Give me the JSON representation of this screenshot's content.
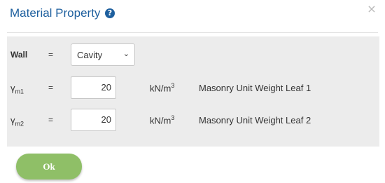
{
  "dialog": {
    "title": "Material Property",
    "help_icon": "question-circle-icon",
    "close_icon": "close-icon",
    "close_glyph": "×"
  },
  "form": {
    "wall": {
      "label": "Wall",
      "equals": "=",
      "selected": "Cavity"
    },
    "gm1": {
      "symbol": "γ",
      "subscript": "m1",
      "equals": "=",
      "value": "20",
      "unit": "kN/m",
      "unit_exp": "3",
      "description": "Masonry Unit Weight Leaf 1"
    },
    "gm2": {
      "symbol": "γ",
      "subscript": "m2",
      "equals": "=",
      "value": "20",
      "unit": "kN/m",
      "unit_exp": "3",
      "description": "Masonry Unit Weight Leaf 2"
    }
  },
  "footer": {
    "ok_label": "Ok"
  },
  "colors": {
    "title": "#1d5f9e",
    "panel_bg": "#ececec",
    "ok_button": "#8fbf67"
  }
}
